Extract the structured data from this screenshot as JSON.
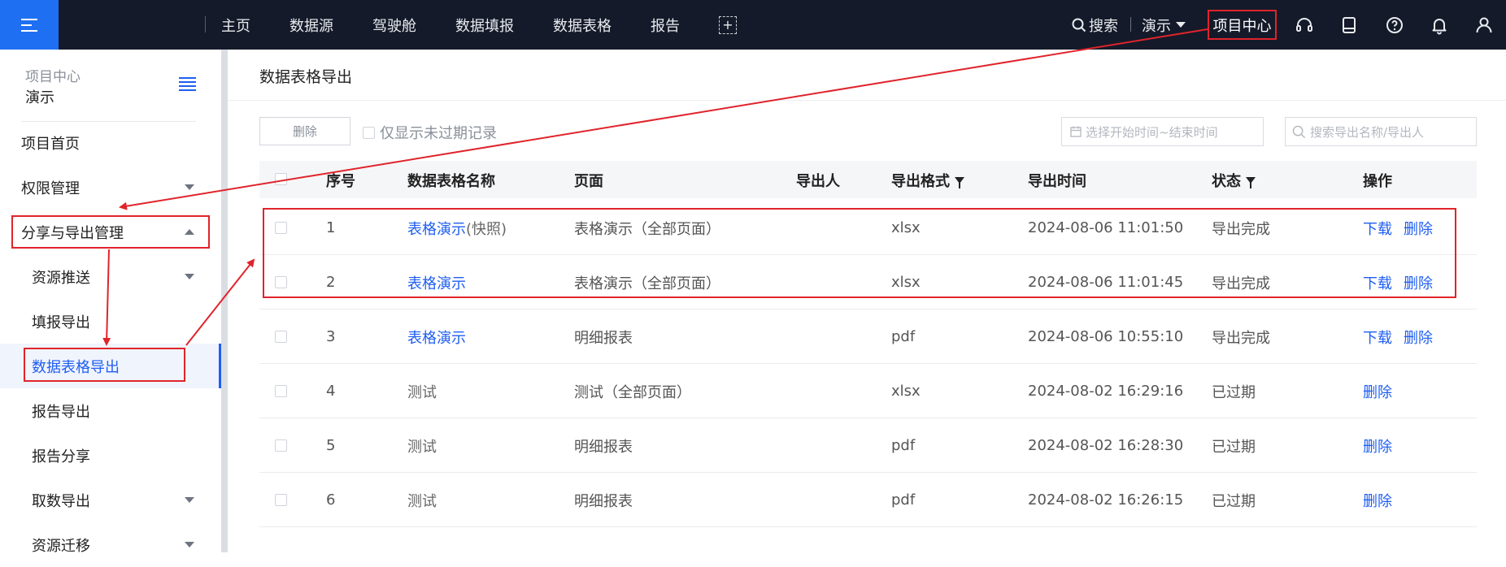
{
  "topbar": {
    "nav_items": [
      "主页",
      "数据源",
      "驾驶舱",
      "数据填报",
      "数据表格",
      "报告"
    ],
    "add_tab": "+",
    "search_label": "搜索",
    "demo_label": "演示",
    "project_center_label": "项目中心",
    "icons": [
      "headset-icon",
      "book-icon",
      "help-icon",
      "bell-icon",
      "user-icon"
    ]
  },
  "sidebar": {
    "header_title": "项目中心",
    "header_project": "演示",
    "items": [
      {
        "label": "项目首页",
        "level": 1,
        "chevron": "none"
      },
      {
        "label": "权限管理",
        "level": 1,
        "chevron": "down"
      },
      {
        "label": "分享与导出管理",
        "level": 1,
        "chevron": "up"
      },
      {
        "label": "资源推送",
        "level": 2,
        "chevron": "down"
      },
      {
        "label": "填报导出",
        "level": 2,
        "chevron": "none"
      },
      {
        "label": "数据表格导出",
        "level": 2,
        "chevron": "none",
        "active": true
      },
      {
        "label": "报告导出",
        "level": 2,
        "chevron": "none"
      },
      {
        "label": "报告分享",
        "level": 2,
        "chevron": "none"
      },
      {
        "label": "取数导出",
        "level": 2,
        "chevron": "down"
      },
      {
        "label": "资源迁移",
        "level": 2,
        "chevron": "down"
      }
    ]
  },
  "main": {
    "page_title": "数据表格导出",
    "delete_button": "删除",
    "only_valid_label": "仅显示未过期记录",
    "date_placeholder": "选择开始时间~结束时间",
    "search_placeholder": "搜索导出名称/导出人",
    "columns": [
      "序号",
      "数据表格名称",
      "页面",
      "导出人",
      "导出格式",
      "导出时间",
      "状态",
      "操作"
    ],
    "rows": [
      {
        "index": "1",
        "name": "表格演示",
        "suffix": " (快照)",
        "name_link": true,
        "page": "表格演示（全部页面）",
        "exporter": "",
        "format": "xlsx",
        "time": "2024-08-06 11:01:50",
        "status": "导出完成",
        "actions": [
          "下载",
          "删除"
        ]
      },
      {
        "index": "2",
        "name": "表格演示",
        "suffix": "",
        "name_link": true,
        "page": "表格演示（全部页面）",
        "exporter": "",
        "format": "xlsx",
        "time": "2024-08-06 11:01:45",
        "status": "导出完成",
        "actions": [
          "下载",
          "删除"
        ]
      },
      {
        "index": "3",
        "name": "表格演示",
        "suffix": "",
        "name_link": true,
        "page": "明细报表",
        "exporter": "",
        "format": "pdf",
        "time": "2024-08-06 10:55:10",
        "status": "导出完成",
        "actions": [
          "下载",
          "删除"
        ]
      },
      {
        "index": "4",
        "name": "测试",
        "suffix": "",
        "name_link": false,
        "page": "测试（全部页面）",
        "exporter": "",
        "format": "xlsx",
        "time": "2024-08-02 16:29:16",
        "status": "已过期",
        "actions": [
          "删除"
        ]
      },
      {
        "index": "5",
        "name": "测试",
        "suffix": "",
        "name_link": false,
        "page": "明细报表",
        "exporter": "",
        "format": "pdf",
        "time": "2024-08-02 16:28:30",
        "status": "已过期",
        "actions": [
          "删除"
        ]
      },
      {
        "index": "6",
        "name": "测试",
        "suffix": "",
        "name_link": false,
        "page": "明细报表",
        "exporter": "",
        "format": "pdf",
        "time": "2024-08-02 16:26:15",
        "status": "已过期",
        "actions": [
          "删除"
        ]
      }
    ]
  },
  "colors": {
    "accent": "#1f5ef2",
    "topbar": "#141a29",
    "highlight": "#e0242b"
  }
}
